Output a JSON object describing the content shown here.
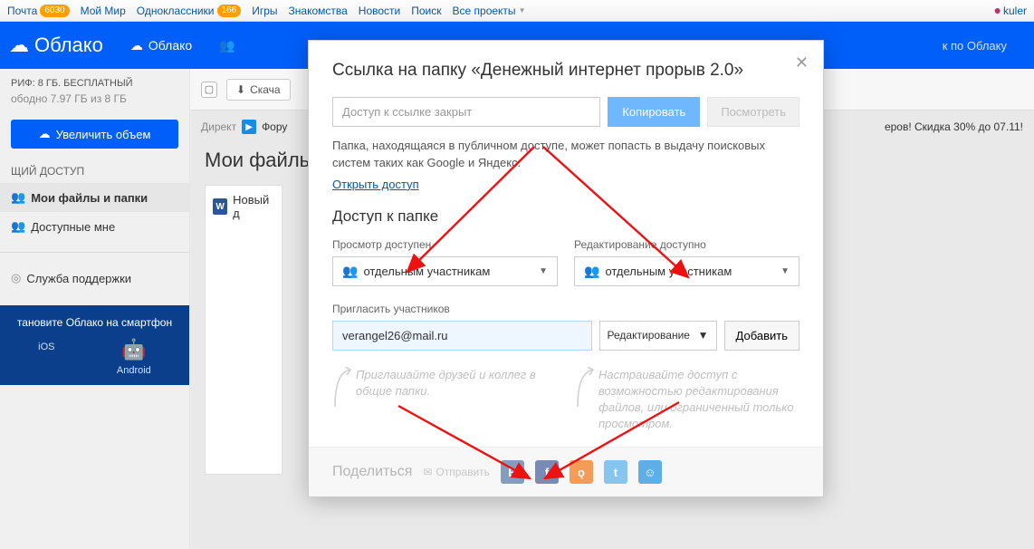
{
  "topbar": {
    "items": [
      {
        "label": "Почта",
        "badge": "6030"
      },
      {
        "label": "Мой Мир"
      },
      {
        "label": "Одноклассники",
        "badge": "166"
      },
      {
        "label": "Игры"
      },
      {
        "label": "Знакомства"
      },
      {
        "label": "Новости"
      },
      {
        "label": "Поиск"
      },
      {
        "label": "Все проекты",
        "caret": true
      }
    ],
    "user": "kuler"
  },
  "header": {
    "app": "Облако",
    "tab_cloud": "Облако",
    "search_hint": "к по Облаку"
  },
  "sidebar": {
    "tariff_line": "РИФ: 8 ГБ. БЕСПЛАТНЫЙ",
    "free_line": "ободно 7.97 ГБ из 8 ГБ",
    "expand_btn": "Увеличить объем",
    "section": "ЩИЙ ДОСТУП",
    "nav_myfiles": "Мои файлы и папки",
    "nav_shared": "Доступные мне",
    "support": "Служба поддержки",
    "smartphone_title": "тановите Облако на смартфон",
    "ios": "iOS",
    "android": "Android"
  },
  "toolbar": {
    "download": "Скача"
  },
  "direct": {
    "label": "Директ",
    "forum": "Фору",
    "promo": "еров! Скидка 30% до 07.11!"
  },
  "main_title": "Мои файль",
  "file": {
    "name": "Новый д"
  },
  "modal": {
    "title": "Ссылка на папку «Денежный интернет прорыв 2.0»",
    "link_placeholder": "Доступ к ссылке закрыт",
    "copy": "Копировать",
    "view": "Посмотреть",
    "note": "Папка, находящаяся в публичном доступе, может попасть в выдачу поисковых систем таких как Google и Яндекс.",
    "open_access": "Открыть доступ",
    "folder_access": "Доступ к папке",
    "view_label": "Просмотр доступен",
    "edit_label": "Редактирование доступно",
    "option_selected": "отдельным участникам",
    "invite_label": "Пригласить участников",
    "email": "verangel26@mail.ru",
    "perm": "Редактирование",
    "add": "Добавить",
    "hint_left": "Приглашайте друзей и коллег в общие папки.",
    "hint_right": "Настраивайте доступ с возможностью редактирования файлов, или ограниченный только просмотром.",
    "share": "Поделиться",
    "send": "Отправить"
  }
}
